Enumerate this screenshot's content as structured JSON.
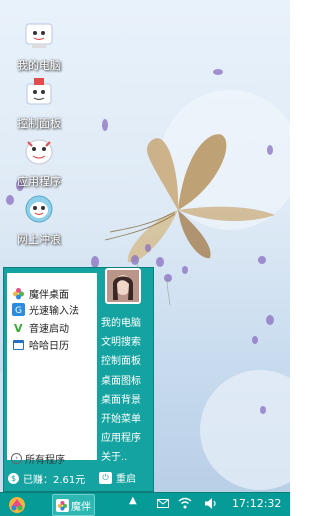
{
  "desktop": {
    "icons": [
      {
        "label": "我的电脑",
        "icon": "cartoon-computer-icon"
      },
      {
        "label": "控制面板",
        "icon": "cartoon-control-panel-icon"
      },
      {
        "label": "应用程序",
        "icon": "cartoon-apps-icon"
      },
      {
        "label": "网上冲浪",
        "icon": "cartoon-internet-icon"
      }
    ]
  },
  "start_menu": {
    "left_items": [
      {
        "label": "魔伴桌面",
        "icon": "flower-icon",
        "color": "#e84b8a"
      },
      {
        "label": "光速输入法",
        "icon": "g-icon",
        "color": "#2a8be0"
      },
      {
        "label": "音速启动",
        "icon": "v-icon",
        "color": "#3aa83a"
      },
      {
        "label": "哈哈日历",
        "icon": "calendar-icon",
        "color": "#2a6fc6"
      }
    ],
    "all_programs": "所有程序",
    "right_items": [
      "我的电脑",
      "文明搜索",
      "控制面板",
      "桌面图标",
      "桌面背景",
      "开始菜单",
      "应用程序",
      "关于.."
    ],
    "earned": "已赚：2.61元",
    "restart": "重启"
  },
  "taskbar": {
    "app_label": "魔伴",
    "time": "17:12:32",
    "accent": "#079b98"
  }
}
